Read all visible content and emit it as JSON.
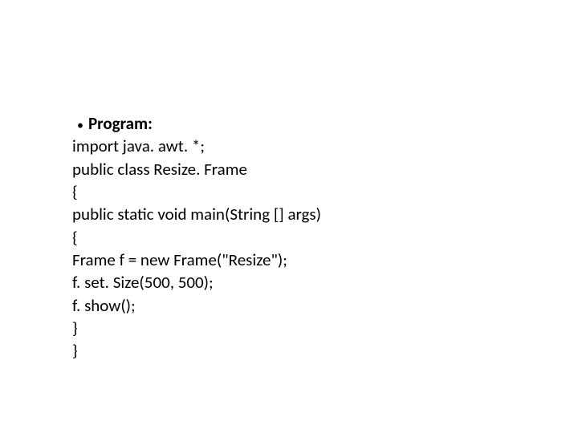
{
  "heading": "Program:",
  "code": {
    "line1": "import java. awt. *;",
    "line2": "public class Resize. Frame",
    "line3": "{",
    "line4": "public static void main(String [] args)",
    "line5": "{",
    "line6": "Frame f = new Frame(\"Resize\");",
    "line7": "f. set. Size(500, 500);",
    "line8": "f. show();",
    "line9": "}",
    "line10": "}"
  }
}
